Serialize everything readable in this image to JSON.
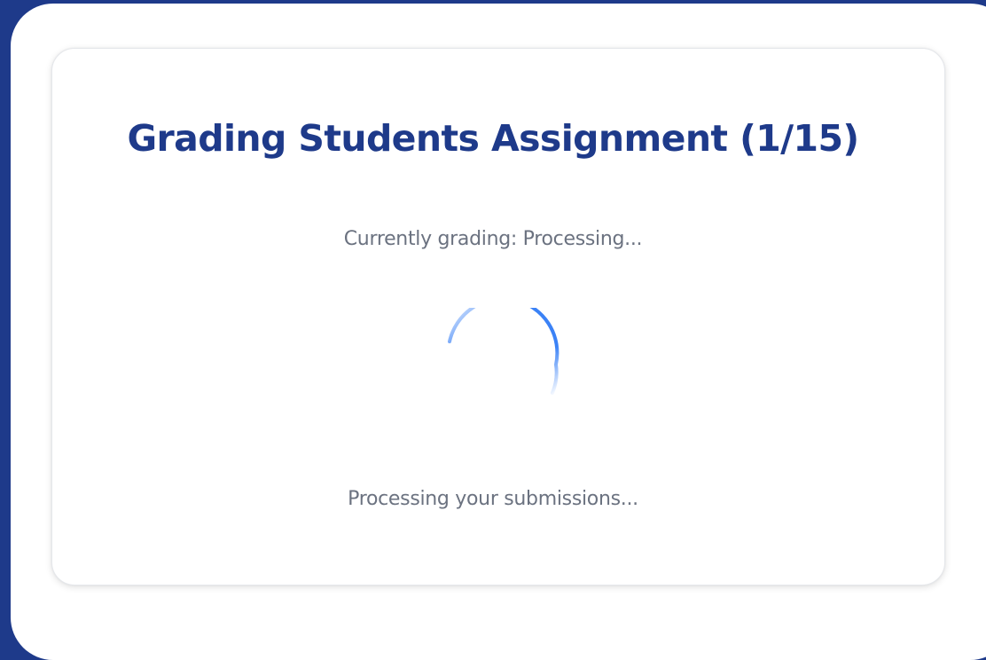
{
  "grading": {
    "title": "Grading Students Assignment (1/15)",
    "progress_current": 1,
    "progress_total": 15,
    "status_text": "Currently grading: Processing...",
    "footer_message": "Processing your submissions...",
    "spinner_icon": "loading-spinner-icon"
  },
  "colors": {
    "background": "#1e3a8a",
    "title": "#1e3a8a",
    "spinner": "#3b82f6",
    "secondary_text": "#6b7280",
    "card": "#ffffff"
  }
}
